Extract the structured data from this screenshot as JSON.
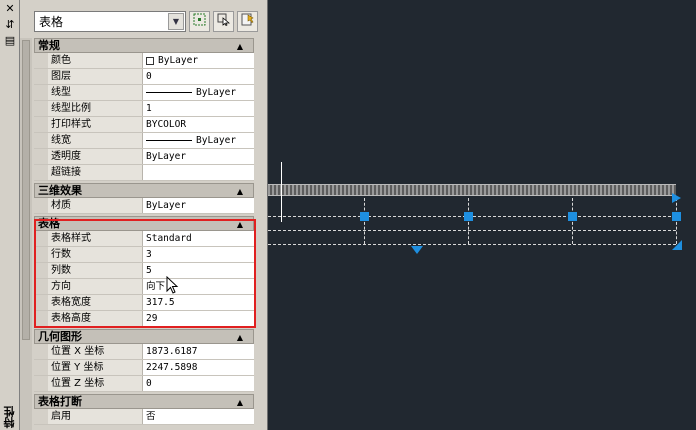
{
  "strip": {
    "title": "特性",
    "close_glyph": "✕",
    "autohide_glyph": "⇵",
    "menu_glyph": "▤"
  },
  "selector": {
    "value": "表格"
  },
  "sections": [
    {
      "title": "常规",
      "rows": [
        {
          "name": "颜色",
          "value": "ByLayer",
          "kind": "color"
        },
        {
          "name": "图层",
          "value": "0"
        },
        {
          "name": "线型",
          "value": "ByLayer",
          "kind": "line"
        },
        {
          "name": "线型比例",
          "value": "1"
        },
        {
          "name": "打印样式",
          "value": "BYCOLOR"
        },
        {
          "name": "线宽",
          "value": "ByLayer",
          "kind": "line"
        },
        {
          "name": "透明度",
          "value": "ByLayer"
        },
        {
          "name": "超链接",
          "value": ""
        }
      ]
    },
    {
      "title": "三维效果",
      "rows": [
        {
          "name": "材质",
          "value": "ByLayer"
        }
      ]
    },
    {
      "title": "表格",
      "rows": [
        {
          "name": "表格样式",
          "value": "Standard"
        },
        {
          "name": "行数",
          "value": "3"
        },
        {
          "name": "列数",
          "value": "5"
        },
        {
          "name": "方向",
          "value": "向下"
        },
        {
          "name": "表格宽度",
          "value": "317.5"
        },
        {
          "name": "表格高度",
          "value": "29"
        }
      ]
    },
    {
      "title": "几何图形",
      "rows": [
        {
          "name": "位置 X 坐标",
          "value": "1873.6187"
        },
        {
          "name": "位置 Y 坐标",
          "value": "2247.5898"
        },
        {
          "name": "位置 Z 坐标",
          "value": "0"
        }
      ]
    },
    {
      "title": "表格打断",
      "rows": [
        {
          "name": "启用",
          "value": "否"
        }
      ]
    }
  ],
  "colors": {
    "canvas_bg": "#212830",
    "grip": "#1e8fe0",
    "highlight": "#e02020"
  }
}
